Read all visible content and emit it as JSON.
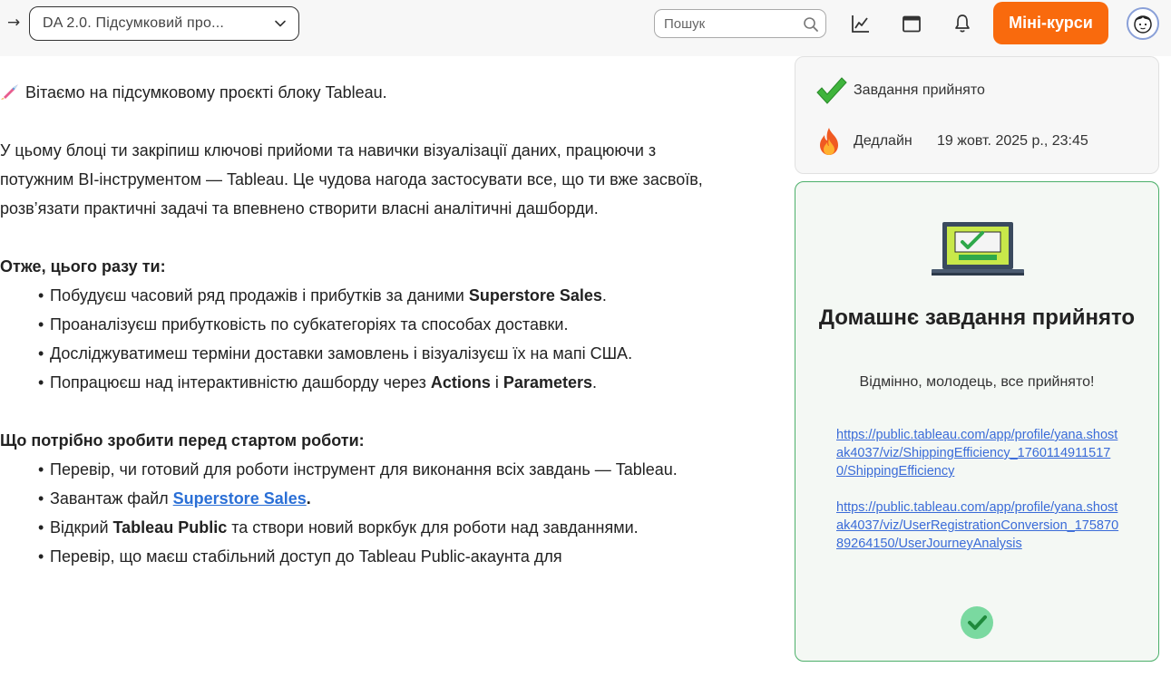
{
  "header": {
    "course_select_value": "DA 2.0. Підсумковий про...",
    "search_placeholder": "Пошук",
    "mini_courses_label": "Міні-курси"
  },
  "content": {
    "intro": "Вітаємо на підсумковому проєкті блоку Tableau.",
    "paragraph": "У цьому блоці ти закріпиш ключові прийоми та навички візуалізації даних, працюючи з потужним BI-інструментом — Tableau. Це чудова нагода застосувати все, що ти вже засвоїв, розв’язати практичні задачі та впевнено створити власні аналітичні дашборди.",
    "heading1": "Отже, цього разу ти:",
    "list1": {
      "item1_text": "Побудуєш часовий ряд продажів і прибутків за даними ",
      "item1_bold": "Superstore Sales",
      "item1_end": ".",
      "item2": "Проаналізуєш прибутковість по субкатегоріях та способах доставки.",
      "item3": "Досліджуватимеш терміни доставки замовлень і візуалізуєш їх на мапі США.",
      "item4_text": "Попрацюєш над інтерактивністю дашборду через ",
      "item4_bold1": "Actions",
      "item4_mid": " і ",
      "item4_bold2": "Parameters",
      "item4_end": "."
    },
    "heading2": "Що потрібно зробити перед стартом роботи:",
    "list2": {
      "item1": "Перевір, чи готовий для роботи інструмент для виконання всіх завдань — Tableau.",
      "item2_text": "Завантаж файл ",
      "item2_link": "Superstore Sales",
      "item2_end": ".",
      "item3_text": "Відкрий ",
      "item3_bold": "Tableau Public",
      "item3_end": " та створи новий воркбук для роботи над завданнями.",
      "item4": "Перевір, що маєш стабільний доступ до Tableau Public-акаунта для"
    }
  },
  "status": {
    "accepted_label": "Завдання прийнято",
    "deadline_label": "Дедлайн",
    "deadline_value": "19 жовт. 2025 р., 23:45"
  },
  "accepted_card": {
    "title": "Домашнє завдання прийнято",
    "subtitle": "Відмінно, молодець, все прийнято!",
    "link1": "https://public.tableau.com/app/profile/yana.shostak4037/viz/ShippingEfficiency_17601149115170/ShippingEfficiency",
    "link2": "https://public.tableau.com/app/profile/yana.shostak4037/viz/UserRegistrationConversion_17587089264150/UserJourneyAnalysis"
  },
  "colors": {
    "accent_orange": "#f96a0d",
    "success_green": "#4caf6a",
    "link_blue": "#3a6bd8"
  }
}
